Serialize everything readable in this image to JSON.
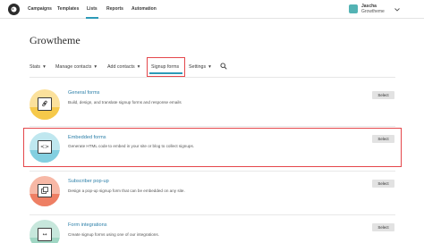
{
  "topnav": {
    "items": [
      {
        "label": "Campaigns"
      },
      {
        "label": "Templates"
      },
      {
        "label": "Lists"
      },
      {
        "label": "Reports"
      },
      {
        "label": "Automation"
      }
    ],
    "active": "Lists",
    "user_name": "Jascha",
    "user_org": "Growtheme"
  },
  "page": {
    "title": "Growtheme"
  },
  "subnav": {
    "items": [
      {
        "label": "Stats",
        "caret": "▾"
      },
      {
        "label": "Manage contacts",
        "caret": "▾"
      },
      {
        "label": "Add contacts",
        "caret": "▾"
      },
      {
        "label": "Signup forms",
        "caret": ""
      },
      {
        "label": "Settings",
        "caret": "▾"
      }
    ],
    "active": "Signup forms",
    "search_icon": "search-icon"
  },
  "forms": [
    {
      "title": "General forms",
      "description": "Build, design, and translate signup forms and response emails",
      "button": "Select",
      "icon": "link-icon",
      "glyph": "🔗",
      "circle_color": "#fbe19c",
      "half_color": "#f6c94a"
    },
    {
      "title": "Embedded forms",
      "description": "Generate HTML code to embed in your site or blog to collect signups.",
      "button": "Select",
      "icon": "code-icon",
      "glyph": "<>",
      "circle_color": "#bfe7ef",
      "half_color": "#83cfe0"
    },
    {
      "title": "Subscriber pop-up",
      "description": "Design a pop-up signup form that can be embedded on any site.",
      "button": "Select",
      "icon": "popup-icon",
      "glyph": "⧉",
      "circle_color": "#f7b8a6",
      "half_color": "#ee7f64"
    },
    {
      "title": "Form integrations",
      "description": "Create signup forms using one of our integrations.",
      "button": "Select",
      "icon": "integration-icon",
      "glyph": "↔",
      "circle_color": "#c7e7dc",
      "half_color": "#9fd6c3"
    }
  ],
  "highlighted_row": "Embedded forms",
  "colors": {
    "link": "#2c7fa8",
    "highlight": "#e4474b",
    "active_underline": "#2c9ab7"
  }
}
